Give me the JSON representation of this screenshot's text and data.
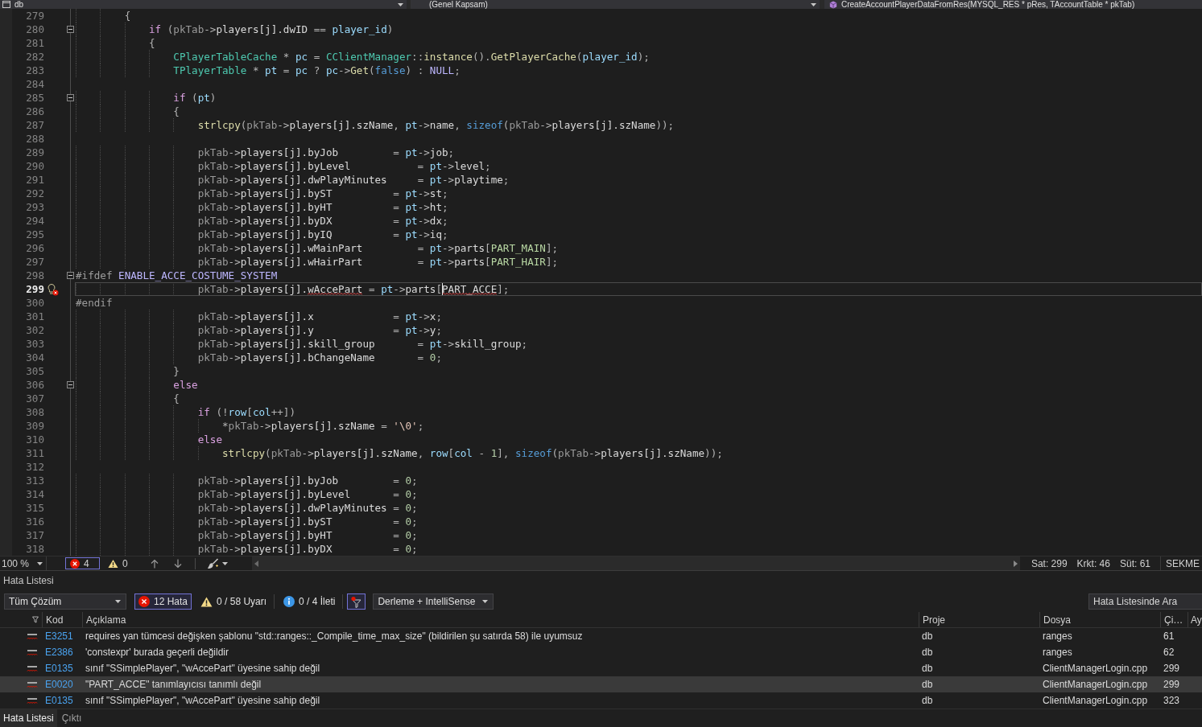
{
  "navigation_bar": {
    "project": "db",
    "scope": "(Genel Kapsam)",
    "member": "CreateAccountPlayerDataFromRes(MYSQL_RES * pRes, TAccountTable * pkTab)"
  },
  "editor": {
    "lines": [
      {
        "number": "279",
        "current": false,
        "tokens": [
          {
            "kind": "plain",
            "text": "        {"
          }
        ]
      },
      {
        "number": "280",
        "current": false,
        "expanded": true,
        "tokens": [
          {
            "kind": "control",
            "text": "            if"
          },
          {
            "kind": "plain",
            "text": " ("
          },
          {
            "kind": "param",
            "text": "pkTab"
          },
          {
            "kind": "plain",
            "text": "->"
          },
          {
            "kind": "member",
            "text": "players[j].dwID"
          },
          {
            "kind": "plain",
            "text": " == "
          },
          {
            "kind": "local",
            "text": "player_id"
          },
          {
            "kind": "plain",
            "text": ")"
          }
        ]
      },
      {
        "number": "281",
        "current": false,
        "tokens": [
          {
            "kind": "plain",
            "text": "            {"
          }
        ]
      },
      {
        "number": "282",
        "current": false,
        "tokens": [
          {
            "kind": "type",
            "text": "                CPlayerTableCache"
          },
          {
            "kind": "plain",
            "text": " * "
          },
          {
            "kind": "local",
            "text": "pc"
          },
          {
            "kind": "plain",
            "text": " = "
          },
          {
            "kind": "type",
            "text": "CClientManager"
          },
          {
            "kind": "plain",
            "text": "::"
          },
          {
            "kind": "func",
            "text": "instance"
          },
          {
            "kind": "plain",
            "text": "()."
          },
          {
            "kind": "func",
            "text": "GetPlayerCache"
          },
          {
            "kind": "plain",
            "text": "("
          },
          {
            "kind": "local",
            "text": "player_id"
          },
          {
            "kind": "plain",
            "text": ");"
          }
        ]
      },
      {
        "number": "283",
        "current": false,
        "tokens": [
          {
            "kind": "type",
            "text": "                TPlayerTable"
          },
          {
            "kind": "plain",
            "text": " * "
          },
          {
            "kind": "local",
            "text": "pt"
          },
          {
            "kind": "plain",
            "text": " = "
          },
          {
            "kind": "local",
            "text": "pc"
          },
          {
            "kind": "plain",
            "text": " ? "
          },
          {
            "kind": "local",
            "text": "pc"
          },
          {
            "kind": "plain",
            "text": "->"
          },
          {
            "kind": "func",
            "text": "Get"
          },
          {
            "kind": "plain",
            "text": "("
          },
          {
            "kind": "keyword",
            "text": "false"
          },
          {
            "kind": "plain",
            "text": ") : "
          },
          {
            "kind": "macro",
            "text": "NULL"
          },
          {
            "kind": "plain",
            "text": ";"
          }
        ]
      },
      {
        "number": "284",
        "current": false
      },
      {
        "number": "285",
        "current": false,
        "expanded": true,
        "tokens": [
          {
            "kind": "control",
            "text": "                if"
          },
          {
            "kind": "plain",
            "text": " ("
          },
          {
            "kind": "local",
            "text": "pt"
          },
          {
            "kind": "plain",
            "text": ")"
          }
        ]
      },
      {
        "number": "286",
        "current": false,
        "tokens": [
          {
            "kind": "plain",
            "text": "                {"
          }
        ]
      },
      {
        "number": "287",
        "current": false,
        "tokens": [
          {
            "kind": "func",
            "text": "                    strlcpy"
          },
          {
            "kind": "plain",
            "text": "("
          },
          {
            "kind": "param",
            "text": "pkTab"
          },
          {
            "kind": "plain",
            "text": "->"
          },
          {
            "kind": "member",
            "text": "players[j].szName"
          },
          {
            "kind": "plain",
            "text": ", "
          },
          {
            "kind": "local",
            "text": "pt"
          },
          {
            "kind": "plain",
            "text": "->"
          },
          {
            "kind": "member",
            "text": "name"
          },
          {
            "kind": "plain",
            "text": ", "
          },
          {
            "kind": "keyword",
            "text": "sizeof"
          },
          {
            "kind": "plain",
            "text": "("
          },
          {
            "kind": "param",
            "text": "pkTab"
          },
          {
            "kind": "plain",
            "text": "->"
          },
          {
            "kind": "member",
            "text": "players[j].szName"
          },
          {
            "kind": "plain",
            "text": "));"
          }
        ]
      },
      {
        "number": "288",
        "current": false
      },
      {
        "number": "289",
        "current": false,
        "tokens": [
          {
            "kind": "param",
            "text": "                    pkTab"
          },
          {
            "kind": "plain",
            "text": "->"
          },
          {
            "kind": "member",
            "text": "players[j].byJob"
          },
          {
            "kind": "plain",
            "text": "         = "
          },
          {
            "kind": "local",
            "text": "pt"
          },
          {
            "kind": "plain",
            "text": "->"
          },
          {
            "kind": "member",
            "text": "job"
          },
          {
            "kind": "plain",
            "text": ";"
          }
        ]
      },
      {
        "number": "290",
        "current": false,
        "tokens": [
          {
            "kind": "param",
            "text": "                    pkTab"
          },
          {
            "kind": "plain",
            "text": "->"
          },
          {
            "kind": "member",
            "text": "players[j].byLevel"
          },
          {
            "kind": "plain",
            "text": "           = "
          },
          {
            "kind": "local",
            "text": "pt"
          },
          {
            "kind": "plain",
            "text": "->"
          },
          {
            "kind": "member",
            "text": "level"
          },
          {
            "kind": "plain",
            "text": ";"
          }
        ]
      },
      {
        "number": "291",
        "current": false,
        "tokens": [
          {
            "kind": "param",
            "text": "                    pkTab"
          },
          {
            "kind": "plain",
            "text": "->"
          },
          {
            "kind": "member",
            "text": "players[j].dwPlayMinutes"
          },
          {
            "kind": "plain",
            "text": "     = "
          },
          {
            "kind": "local",
            "text": "pt"
          },
          {
            "kind": "plain",
            "text": "->"
          },
          {
            "kind": "member",
            "text": "playtime"
          },
          {
            "kind": "plain",
            "text": ";"
          }
        ]
      },
      {
        "number": "292",
        "current": false,
        "tokens": [
          {
            "kind": "param",
            "text": "                    pkTab"
          },
          {
            "kind": "plain",
            "text": "->"
          },
          {
            "kind": "member",
            "text": "players[j].byST"
          },
          {
            "kind": "plain",
            "text": "          = "
          },
          {
            "kind": "local",
            "text": "pt"
          },
          {
            "kind": "plain",
            "text": "->"
          },
          {
            "kind": "member",
            "text": "st"
          },
          {
            "kind": "plain",
            "text": ";"
          }
        ]
      },
      {
        "number": "293",
        "current": false,
        "tokens": [
          {
            "kind": "param",
            "text": "                    pkTab"
          },
          {
            "kind": "plain",
            "text": "->"
          },
          {
            "kind": "member",
            "text": "players[j].byHT"
          },
          {
            "kind": "plain",
            "text": "          = "
          },
          {
            "kind": "local",
            "text": "pt"
          },
          {
            "kind": "plain",
            "text": "->"
          },
          {
            "kind": "member",
            "text": "ht"
          },
          {
            "kind": "plain",
            "text": ";"
          }
        ]
      },
      {
        "number": "294",
        "current": false,
        "tokens": [
          {
            "kind": "param",
            "text": "                    pkTab"
          },
          {
            "kind": "plain",
            "text": "->"
          },
          {
            "kind": "member",
            "text": "players[j].byDX"
          },
          {
            "kind": "plain",
            "text": "          = "
          },
          {
            "kind": "local",
            "text": "pt"
          },
          {
            "kind": "plain",
            "text": "->"
          },
          {
            "kind": "member",
            "text": "dx"
          },
          {
            "kind": "plain",
            "text": ";"
          }
        ]
      },
      {
        "number": "295",
        "current": false,
        "tokens": [
          {
            "kind": "param",
            "text": "                    pkTab"
          },
          {
            "kind": "plain",
            "text": "->"
          },
          {
            "kind": "member",
            "text": "players[j].byIQ"
          },
          {
            "kind": "plain",
            "text": "          = "
          },
          {
            "kind": "local",
            "text": "pt"
          },
          {
            "kind": "plain",
            "text": "->"
          },
          {
            "kind": "member",
            "text": "iq"
          },
          {
            "kind": "plain",
            "text": ";"
          }
        ]
      },
      {
        "number": "296",
        "current": false,
        "tokens": [
          {
            "kind": "param",
            "text": "                    pkTab"
          },
          {
            "kind": "plain",
            "text": "->"
          },
          {
            "kind": "member",
            "text": "players[j].wMainPart"
          },
          {
            "kind": "plain",
            "text": "         = "
          },
          {
            "kind": "local",
            "text": "pt"
          },
          {
            "kind": "plain",
            "text": "->"
          },
          {
            "kind": "member",
            "text": "parts"
          },
          {
            "kind": "plain",
            "text": "["
          },
          {
            "kind": "enum",
            "text": "PART_MAIN"
          },
          {
            "kind": "plain",
            "text": "];"
          }
        ]
      },
      {
        "number": "297",
        "current": false,
        "tokens": [
          {
            "kind": "param",
            "text": "                    pkTab"
          },
          {
            "kind": "plain",
            "text": "->"
          },
          {
            "kind": "member",
            "text": "players[j].wHairPart"
          },
          {
            "kind": "plain",
            "text": "         = "
          },
          {
            "kind": "local",
            "text": "pt"
          },
          {
            "kind": "plain",
            "text": "->"
          },
          {
            "kind": "member",
            "text": "parts"
          },
          {
            "kind": "plain",
            "text": "["
          },
          {
            "kind": "enum",
            "text": "PART_HAIR"
          },
          {
            "kind": "plain",
            "text": "];"
          }
        ]
      },
      {
        "number": "298",
        "current": false,
        "expanded": true,
        "tokens": [
          {
            "kind": "directive",
            "text": "#ifdef "
          },
          {
            "kind": "macro",
            "text": "ENABLE_ACCE_COSTUME_SYSTEM"
          }
        ]
      },
      {
        "number": "299",
        "current": true,
        "error_hint": true,
        "tokens": [
          {
            "kind": "param",
            "text": "                    pkTab"
          },
          {
            "kind": "plain",
            "text": "->"
          },
          {
            "kind": "member",
            "text": "players[j]."
          },
          {
            "kind": "member",
            "text": "wAccePart",
            "error": true
          },
          {
            "kind": "plain",
            "text": " = "
          },
          {
            "kind": "local",
            "text": "pt"
          },
          {
            "kind": "plain",
            "text": "->"
          },
          {
            "kind": "member",
            "text": "parts"
          },
          {
            "kind": "plain",
            "text": "["
          },
          {
            "kind": "member",
            "text": "PART_ACCE",
            "error": true,
            "caret": true
          },
          {
            "kind": "plain",
            "text": "];"
          }
        ]
      },
      {
        "number": "300",
        "current": false,
        "tokens": [
          {
            "kind": "directive",
            "text": "#endif"
          }
        ]
      },
      {
        "number": "301",
        "current": false,
        "tokens": [
          {
            "kind": "param",
            "text": "                    pkTab"
          },
          {
            "kind": "plain",
            "text": "->"
          },
          {
            "kind": "member",
            "text": "players[j].x"
          },
          {
            "kind": "plain",
            "text": "             = "
          },
          {
            "kind": "local",
            "text": "pt"
          },
          {
            "kind": "plain",
            "text": "->"
          },
          {
            "kind": "member",
            "text": "x"
          },
          {
            "kind": "plain",
            "text": ";"
          }
        ]
      },
      {
        "number": "302",
        "current": false,
        "tokens": [
          {
            "kind": "param",
            "text": "                    pkTab"
          },
          {
            "kind": "plain",
            "text": "->"
          },
          {
            "kind": "member",
            "text": "players[j].y"
          },
          {
            "kind": "plain",
            "text": "             = "
          },
          {
            "kind": "local",
            "text": "pt"
          },
          {
            "kind": "plain",
            "text": "->"
          },
          {
            "kind": "member",
            "text": "y"
          },
          {
            "kind": "plain",
            "text": ";"
          }
        ]
      },
      {
        "number": "303",
        "current": false,
        "tokens": [
          {
            "kind": "param",
            "text": "                    pkTab"
          },
          {
            "kind": "plain",
            "text": "->"
          },
          {
            "kind": "member",
            "text": "players[j].skill_group"
          },
          {
            "kind": "plain",
            "text": "       = "
          },
          {
            "kind": "local",
            "text": "pt"
          },
          {
            "kind": "plain",
            "text": "->"
          },
          {
            "kind": "member",
            "text": "skill_group"
          },
          {
            "kind": "plain",
            "text": ";"
          }
        ]
      },
      {
        "number": "304",
        "current": false,
        "tokens": [
          {
            "kind": "param",
            "text": "                    pkTab"
          },
          {
            "kind": "plain",
            "text": "->"
          },
          {
            "kind": "member",
            "text": "players[j].bChangeName"
          },
          {
            "kind": "plain",
            "text": "       = "
          },
          {
            "kind": "number",
            "text": "0"
          },
          {
            "kind": "plain",
            "text": ";"
          }
        ]
      },
      {
        "number": "305",
        "current": false,
        "tokens": [
          {
            "kind": "plain",
            "text": "                }"
          }
        ]
      },
      {
        "number": "306",
        "current": false,
        "expanded": true,
        "tokens": [
          {
            "kind": "control",
            "text": "                else"
          }
        ]
      },
      {
        "number": "307",
        "current": false,
        "tokens": [
          {
            "kind": "plain",
            "text": "                {"
          }
        ]
      },
      {
        "number": "308",
        "current": false,
        "tokens": [
          {
            "kind": "control",
            "text": "                    if"
          },
          {
            "kind": "plain",
            "text": " (!"
          },
          {
            "kind": "local",
            "text": "row"
          },
          {
            "kind": "plain",
            "text": "["
          },
          {
            "kind": "local",
            "text": "col"
          },
          {
            "kind": "plain",
            "text": "++])"
          }
        ]
      },
      {
        "number": "309",
        "current": false,
        "tokens": [
          {
            "kind": "plain",
            "text": "                        *"
          },
          {
            "kind": "param",
            "text": "pkTab"
          },
          {
            "kind": "plain",
            "text": "->"
          },
          {
            "kind": "member",
            "text": "players[j].szName"
          },
          {
            "kind": "plain",
            "text": " = "
          },
          {
            "kind": "char",
            "text": "'\\0'"
          },
          {
            "kind": "plain",
            "text": ";"
          }
        ]
      },
      {
        "number": "310",
        "current": false,
        "tokens": [
          {
            "kind": "control",
            "text": "                    else"
          }
        ]
      },
      {
        "number": "311",
        "current": false,
        "tokens": [
          {
            "kind": "func",
            "text": "                        strlcpy"
          },
          {
            "kind": "plain",
            "text": "("
          },
          {
            "kind": "param",
            "text": "pkTab"
          },
          {
            "kind": "plain",
            "text": "->"
          },
          {
            "kind": "member",
            "text": "players[j].szName"
          },
          {
            "kind": "plain",
            "text": ", "
          },
          {
            "kind": "local",
            "text": "row"
          },
          {
            "kind": "plain",
            "text": "["
          },
          {
            "kind": "local",
            "text": "col"
          },
          {
            "kind": "plain",
            "text": " - "
          },
          {
            "kind": "number",
            "text": "1"
          },
          {
            "kind": "plain",
            "text": "], "
          },
          {
            "kind": "keyword",
            "text": "sizeof"
          },
          {
            "kind": "plain",
            "text": "("
          },
          {
            "kind": "param",
            "text": "pkTab"
          },
          {
            "kind": "plain",
            "text": "->"
          },
          {
            "kind": "member",
            "text": "players[j].szName"
          },
          {
            "kind": "plain",
            "text": "));"
          }
        ]
      },
      {
        "number": "312",
        "current": false
      },
      {
        "number": "313",
        "current": false,
        "tokens": [
          {
            "kind": "param",
            "text": "                    pkTab"
          },
          {
            "kind": "plain",
            "text": "->"
          },
          {
            "kind": "member",
            "text": "players[j].byJob"
          },
          {
            "kind": "plain",
            "text": "         = "
          },
          {
            "kind": "number",
            "text": "0"
          },
          {
            "kind": "plain",
            "text": ";"
          }
        ]
      },
      {
        "number": "314",
        "current": false,
        "tokens": [
          {
            "kind": "param",
            "text": "                    pkTab"
          },
          {
            "kind": "plain",
            "text": "->"
          },
          {
            "kind": "member",
            "text": "players[j].byLevel"
          },
          {
            "kind": "plain",
            "text": "       = "
          },
          {
            "kind": "number",
            "text": "0"
          },
          {
            "kind": "plain",
            "text": ";"
          }
        ]
      },
      {
        "number": "315",
        "current": false,
        "tokens": [
          {
            "kind": "param",
            "text": "                    pkTab"
          },
          {
            "kind": "plain",
            "text": "->"
          },
          {
            "kind": "member",
            "text": "players[j].dwPlayMinutes"
          },
          {
            "kind": "plain",
            "text": " = "
          },
          {
            "kind": "number",
            "text": "0"
          },
          {
            "kind": "plain",
            "text": ";"
          }
        ]
      },
      {
        "number": "316",
        "current": false,
        "tokens": [
          {
            "kind": "param",
            "text": "                    pkTab"
          },
          {
            "kind": "plain",
            "text": "->"
          },
          {
            "kind": "member",
            "text": "players[j].byST"
          },
          {
            "kind": "plain",
            "text": "          = "
          },
          {
            "kind": "number",
            "text": "0"
          },
          {
            "kind": "plain",
            "text": ";"
          }
        ]
      },
      {
        "number": "317",
        "current": false,
        "tokens": [
          {
            "kind": "param",
            "text": "                    pkTab"
          },
          {
            "kind": "plain",
            "text": "->"
          },
          {
            "kind": "member",
            "text": "players[j].byHT"
          },
          {
            "kind": "plain",
            "text": "          = "
          },
          {
            "kind": "number",
            "text": "0"
          },
          {
            "kind": "plain",
            "text": ";"
          }
        ]
      },
      {
        "number": "318",
        "current": false,
        "tokens": [
          {
            "kind": "param",
            "text": "                    pkTab"
          },
          {
            "kind": "plain",
            "text": "->"
          },
          {
            "kind": "member",
            "text": "players[j].byDX"
          },
          {
            "kind": "plain",
            "text": "          = "
          },
          {
            "kind": "number",
            "text": "0"
          },
          {
            "kind": "plain",
            "text": ";"
          }
        ]
      }
    ]
  },
  "editor_status": {
    "zoom": "100 %",
    "errors": "4",
    "warnings": "0",
    "line": "Sat: 299",
    "character": "Krkt: 46",
    "column": "Süt: 61",
    "indent_mode": "SEKME"
  },
  "error_list": {
    "title": "Hata Listesi",
    "scope": "Tüm Çözüm",
    "filters": [
      {
        "kind": "error",
        "label": "12 Hata",
        "selected": true
      },
      {
        "kind": "warning",
        "label": "0 / 58 Uyarı",
        "selected": false
      },
      {
        "kind": "info",
        "label": "0 / 4 İleti",
        "selected": false
      }
    ],
    "filter_button": {
      "selected": true
    },
    "build_source": "Derleme + IntelliSense",
    "search": {
      "placeholder": "Hata Listesinde Ara"
    },
    "columns": [
      "Kod",
      "Açıklama",
      "Proje",
      "Dosya",
      "Çi…",
      "Ay"
    ],
    "rows": [
      {
        "code": "E3251",
        "description": "requires yan tümcesi değişken şablonu \"std::ranges::_Compile_time_max_size\" (bildirilen şu satırda 58) ile uyumsuz",
        "project": "db",
        "file": "ranges",
        "line": "61",
        "selected": false
      },
      {
        "code": "E2386",
        "description": "'constexpr' burada geçerli değildir",
        "project": "db",
        "file": "ranges",
        "line": "62",
        "selected": false
      },
      {
        "code": "E0135",
        "description": "sınıf \"SSimplePlayer\", \"wAccePart\" üyesine sahip değil",
        "project": "db",
        "file": "ClientManagerLogin.cpp",
        "line": "299",
        "selected": false
      },
      {
        "code": "E0020",
        "description": "\"PART_ACCE\" tanımlayıcısı tanımlı değil",
        "project": "db",
        "file": "ClientManagerLogin.cpp",
        "line": "299",
        "selected": true
      },
      {
        "code": "E0135",
        "description": "sınıf \"SSimplePlayer\", \"wAccePart\" üyesine sahip değil",
        "project": "db",
        "file": "ClientManagerLogin.cpp",
        "line": "323",
        "selected": false
      }
    ]
  },
  "bottom_tabs": [
    {
      "label": "Hata Listesi",
      "selected": true
    },
    {
      "label": "Çıktı",
      "selected": false
    }
  ]
}
